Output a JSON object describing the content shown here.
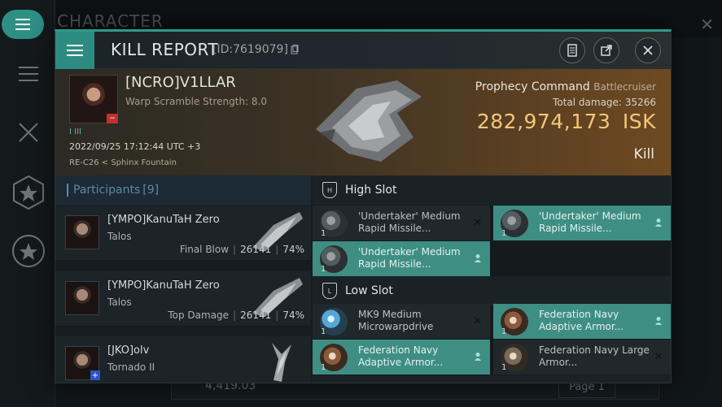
{
  "background": {
    "title": "CHARACTER",
    "amount": "4,419.03",
    "page_label": "Page 1"
  },
  "modal": {
    "title": "KILL REPORT",
    "report_id": "[ID:7619079]"
  },
  "victim": {
    "name": "[NCRO]V1LLAR",
    "warp_scramble": "Warp Scramble Strength: 8.0",
    "corp_tag": "I III",
    "date": "2022/09/25 17:12:44 UTC +3",
    "location": "RE-C26 < Sphinx Fountain",
    "ship_name": "Prophecy Command",
    "ship_class": "Battlecruiser",
    "total_damage_label": "Total damage:",
    "total_damage": "35266",
    "isk_value": "282,974,173",
    "isk_unit": "ISK",
    "result": "Kill"
  },
  "participants": {
    "header": "Participants",
    "count": "[9]",
    "rows": [
      {
        "name": "[YMPO]KanuTaH Zero",
        "ship": "Talos",
        "role": "Final Blow",
        "damage": "26141",
        "percent": "74%"
      },
      {
        "name": "[YMPO]KanuTaH Zero",
        "ship": "Talos",
        "role": "Top Damage",
        "damage": "26141",
        "percent": "74%"
      },
      {
        "name": "[JKO]olv",
        "ship": "Tornado II",
        "role": "",
        "damage": "",
        "percent": ""
      }
    ]
  },
  "slots": {
    "high": {
      "label": "High Slot",
      "modules": [
        {
          "qty": "1",
          "name": "'Undertaker' Medium Rapid Missile...",
          "state": "dropped"
        },
        {
          "qty": "1",
          "name": "'Undertaker' Medium Rapid Missile...",
          "state": "destroyed"
        },
        {
          "qty": "1",
          "name": "'Undertaker' Medium Rapid Missile...",
          "state": "destroyed"
        }
      ]
    },
    "low": {
      "label": "Low Slot",
      "modules": [
        {
          "qty": "1",
          "name": "MK9 Medium Microwarpdrive",
          "state": "dropped"
        },
        {
          "qty": "1",
          "name": "Federation Navy Adaptive Armor...",
          "state": "destroyed"
        },
        {
          "qty": "1",
          "name": "Federation Navy Adaptive Armor...",
          "state": "destroyed"
        },
        {
          "qty": "1",
          "name": "Federation Navy Large Armor...",
          "state": "dropped"
        }
      ]
    }
  },
  "colors": {
    "accent": "#2f9a8c",
    "isk": "#f3c77a",
    "destroyed_module": "#3e8e84"
  }
}
